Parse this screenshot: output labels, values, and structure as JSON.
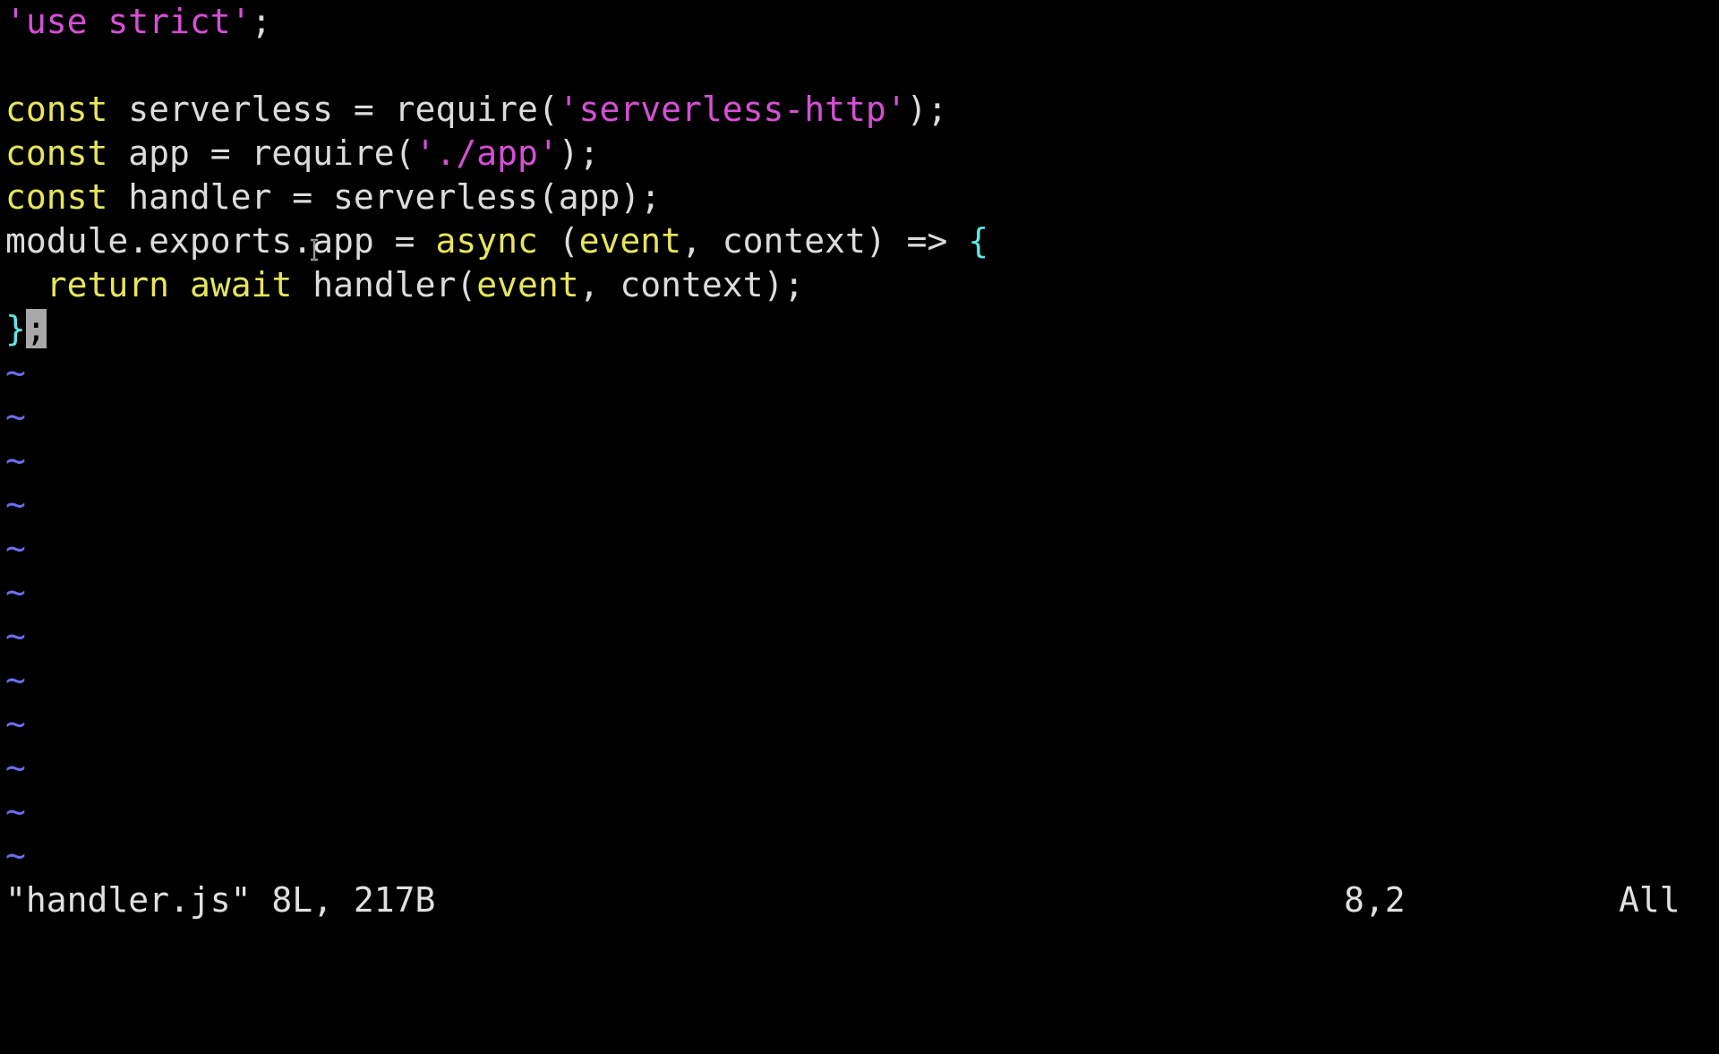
{
  "editor": {
    "lines": [
      {
        "tokens": [
          {
            "t": "'use strict'",
            "k": "str"
          },
          {
            "t": ";",
            "k": "plain"
          }
        ]
      },
      {
        "tokens": []
      },
      {
        "tokens": [
          {
            "t": "const",
            "k": "kw"
          },
          {
            "t": " serverless = require(",
            "k": "plain"
          },
          {
            "t": "'serverless-http'",
            "k": "str"
          },
          {
            "t": ");",
            "k": "plain"
          }
        ]
      },
      {
        "tokens": [
          {
            "t": "const",
            "k": "kw"
          },
          {
            "t": " app = require(",
            "k": "plain"
          },
          {
            "t": "'./app'",
            "k": "str"
          },
          {
            "t": ");",
            "k": "plain"
          }
        ]
      },
      {
        "tokens": [
          {
            "t": "const",
            "k": "kw"
          },
          {
            "t": " handler = serverless(app);",
            "k": "plain"
          }
        ]
      },
      {
        "tokens": [
          {
            "t": "module.exports.app = ",
            "k": "plain"
          },
          {
            "t": "async",
            "k": "kw"
          },
          {
            "t": " (",
            "k": "plain"
          },
          {
            "t": "event",
            "k": "kw"
          },
          {
            "t": ", context) => ",
            "k": "plain"
          },
          {
            "t": "{",
            "k": "brace"
          }
        ]
      },
      {
        "tokens": [
          {
            "t": "  ",
            "k": "plain"
          },
          {
            "t": "return",
            "k": "kw"
          },
          {
            "t": " ",
            "k": "plain"
          },
          {
            "t": "await",
            "k": "kw"
          },
          {
            "t": " handler(",
            "k": "plain"
          },
          {
            "t": "event",
            "k": "kw"
          },
          {
            "t": ", context);",
            "k": "plain"
          }
        ]
      },
      {
        "tokens": [
          {
            "t": "}",
            "k": "brace"
          },
          {
            "t": ";",
            "k": "cursor"
          }
        ]
      }
    ],
    "empty_line_marker": "~",
    "empty_line_count": 12
  },
  "status": {
    "file_info": "\"handler.js\" 8L, 217B",
    "cursor_position": "8,2",
    "scroll_indicator": "All"
  },
  "colors": {
    "string": "#d64fd6",
    "keyword": "#e6e65c",
    "text": "#dcdcdc",
    "brace": "#5ee6e6",
    "tilde": "#6d6df0",
    "background": "#000000"
  }
}
